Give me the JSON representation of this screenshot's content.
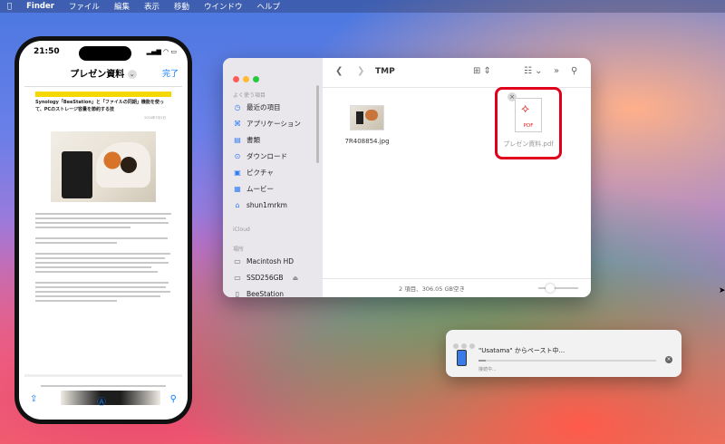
{
  "menubar": {
    "items": [
      "Finder",
      "ファイル",
      "編集",
      "表示",
      "移動",
      "ウインドウ",
      "ヘルプ"
    ]
  },
  "phone": {
    "time": "21:50",
    "title": "プレゼン資料",
    "done": "完了",
    "doc": {
      "headline": "Synology「BeeStation」と「ファイルの同期」機能を使って、PCのストレージ容量を節約する技",
      "date": "2024年7月1日"
    }
  },
  "finder": {
    "sidebar": {
      "section_favorites": "よく使う項目",
      "favorites": [
        {
          "label": "最近の項目",
          "icon": "clock-icon"
        },
        {
          "label": "アプリケーション",
          "icon": "apps-icon"
        },
        {
          "label": "書類",
          "icon": "document-icon"
        },
        {
          "label": "ダウンロード",
          "icon": "download-icon"
        },
        {
          "label": "ピクチャ",
          "icon": "picture-icon"
        },
        {
          "label": "ムービー",
          "icon": "movie-icon"
        },
        {
          "label": "shun1mrkm",
          "icon": "home-icon"
        }
      ],
      "section_icloud": "iCloud",
      "section_locations": "場所",
      "locations": [
        {
          "label": "Macintosh HD",
          "icon": "disk-icon"
        },
        {
          "label": "SSD256GB",
          "icon": "disk-icon"
        },
        {
          "label": "BeeStation",
          "icon": "nas-icon"
        }
      ]
    },
    "title": "TMP",
    "files": [
      {
        "name": "7R408854.jpg"
      },
      {
        "name": "プレゼン資料.pdf"
      }
    ],
    "status": "2 項目、306.05 GB空き"
  },
  "paste_dialog": {
    "message": "\"Usatama\" からペースト中...",
    "sub": "接続中...",
    "progress": 0.04
  }
}
